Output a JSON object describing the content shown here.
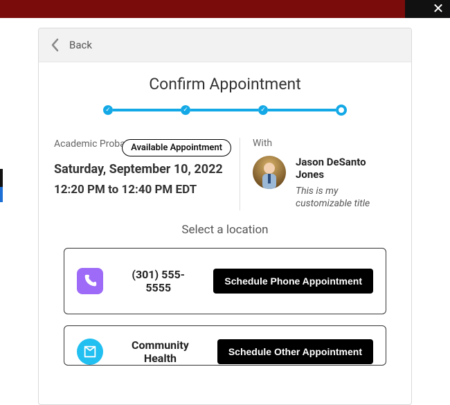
{
  "header": {
    "back_label": "Back"
  },
  "title": "Confirm Appointment",
  "progress": {
    "steps_total": 4,
    "steps_done": 3
  },
  "appointment": {
    "service": "Academic Probation/Dismissal",
    "badge": "Available Appointment",
    "date": "Saturday, September 10, 2022",
    "time": "12:20 PM to 12:40 PM EDT",
    "with_label": "With",
    "staff": {
      "name": "Jason DeSanto Jones",
      "subtitle": "This is my customizable title"
    }
  },
  "locations": {
    "heading": "Select a location",
    "options": [
      {
        "icon": "phone-icon",
        "icon_bg": "#9d6bf7",
        "label": "(301) 555-5555",
        "button": "Schedule Phone Appointment"
      },
      {
        "icon": "building-icon",
        "icon_bg": "#22bff1",
        "label": "Community Health",
        "button": "Schedule Other Appointment"
      }
    ]
  },
  "close_label": "✕"
}
